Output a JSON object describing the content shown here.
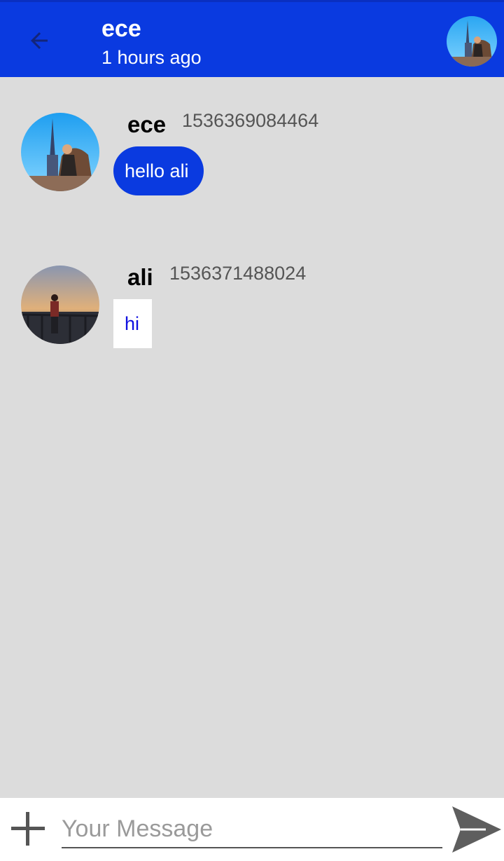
{
  "header": {
    "title": "ece",
    "subtitle": "1 hours ago",
    "back_icon": "arrow-left-icon",
    "avatar_icon": "user-avatar-photo"
  },
  "messages": [
    {
      "sender": "ece",
      "timestamp": "1536369084464",
      "text": "hello ali",
      "style": "blue-bubble"
    },
    {
      "sender": "ali",
      "timestamp": "1536371488024",
      "text": "hi",
      "style": "white-box"
    }
  ],
  "composer": {
    "placeholder": "Your Message",
    "add_icon": "plus-icon",
    "send_icon": "send-icon"
  },
  "colors": {
    "accent": "#0a3ae0",
    "background": "#dcdcdc",
    "reply_text": "#1010e0"
  }
}
